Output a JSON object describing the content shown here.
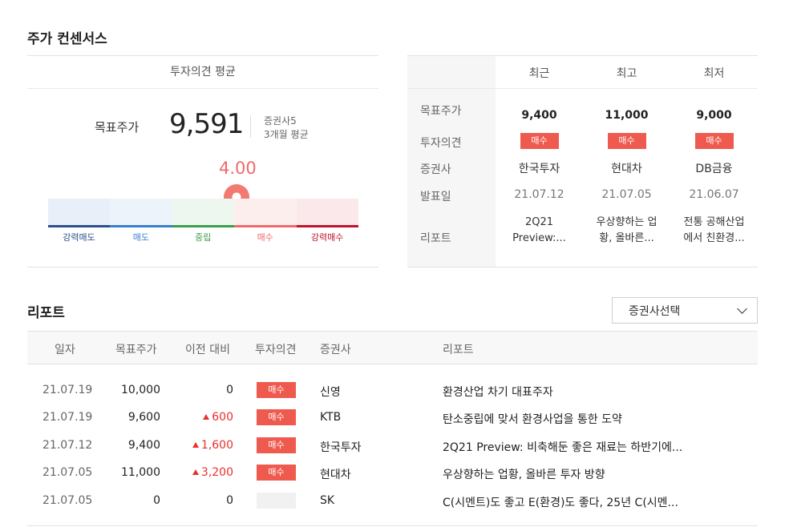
{
  "consensus": {
    "title": "주가 컨센서스",
    "average_header": "투자의견 평균",
    "target_label": "목표주가",
    "target_value": "9,591",
    "brokers_count": "증권사5",
    "period": "3개월 평균",
    "score": "4.00",
    "score_fraction": 0.75,
    "bands": [
      {
        "label": "강력매도",
        "color": "#2c4f8e",
        "bg": "#e9eff8"
      },
      {
        "label": "매도",
        "color": "#3a7ed0",
        "bg": "#edf3fb"
      },
      {
        "label": "중립",
        "color": "#3a9e4c",
        "bg": "#eef7ef"
      },
      {
        "label": "매수",
        "color": "#ef6a6a",
        "bg": "#fdeeee"
      },
      {
        "label": "강력매수",
        "color": "#c0132d",
        "bg": "#fbe8ea"
      }
    ],
    "compare": {
      "headers": [
        "최근",
        "최고",
        "최저"
      ],
      "row_labels": [
        "목표주가",
        "투자의견",
        "증권사",
        "발표일",
        "리포트"
      ],
      "columns": [
        {
          "target": "9,400",
          "opinion": "매수",
          "broker": "한국투자",
          "date": "21.07.12",
          "report_line1": "2Q21",
          "report_line2": "Preview:..."
        },
        {
          "target": "11,000",
          "opinion": "매수",
          "broker": "현대차",
          "date": "21.07.05",
          "report_line1": "우상향하는 업",
          "report_line2": "황, 올바른..."
        },
        {
          "target": "9,000",
          "opinion": "매수",
          "broker": "DB금융",
          "date": "21.06.07",
          "report_line1": "전통 공해산업",
          "report_line2": "에서 친환경..."
        }
      ]
    }
  },
  "reports": {
    "title": "리포트",
    "broker_select": "증권사선택",
    "headers": [
      "일자",
      "목표주가",
      "이전 대비",
      "투자의견",
      "증권사",
      "리포트"
    ],
    "rows": [
      {
        "date": "21.07.19",
        "target": "10,000",
        "change": "0",
        "up": false,
        "opinion": "매수",
        "broker": "신영",
        "title": "환경산업 차기 대표주자"
      },
      {
        "date": "21.07.19",
        "target": "9,600",
        "change": "600",
        "up": true,
        "opinion": "매수",
        "broker": "KTB",
        "title": "탄소중립에 맞서 환경사업을 통한 도약"
      },
      {
        "date": "21.07.12",
        "target": "9,400",
        "change": "1,600",
        "up": true,
        "opinion": "매수",
        "broker": "한국투자",
        "title": "2Q21 Preview: 비축해둔 좋은 재료는 하반기에..."
      },
      {
        "date": "21.07.05",
        "target": "11,000",
        "change": "3,200",
        "up": true,
        "opinion": "매수",
        "broker": "현대차",
        "title": "우상향하는 업황, 올바른 투자 방향"
      },
      {
        "date": "21.07.05",
        "target": "0",
        "change": "0",
        "up": false,
        "opinion": "",
        "broker": "SK",
        "title": "C(시멘트)도 좋고 E(환경)도 좋다, 25년 C(시멘..."
      }
    ]
  }
}
